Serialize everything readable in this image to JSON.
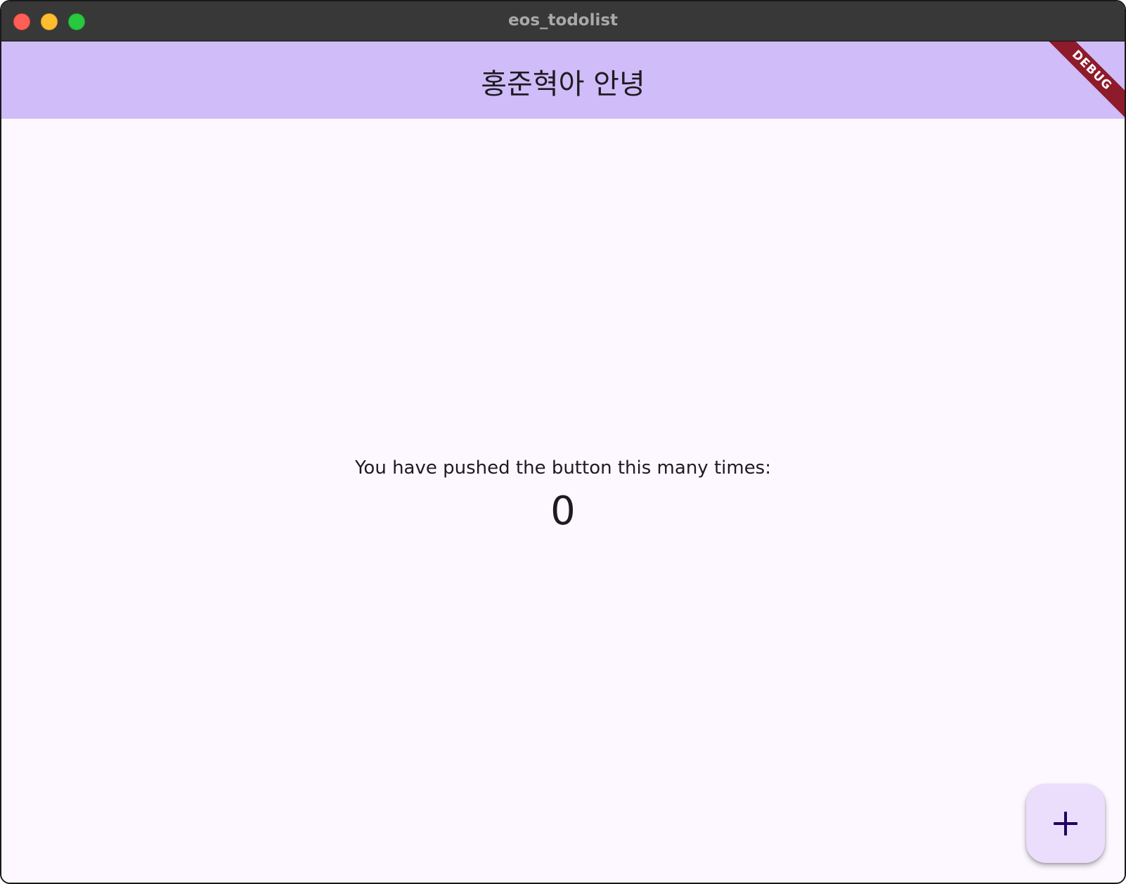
{
  "window": {
    "title": "eos_todolist",
    "controls": [
      "close-button",
      "minimize-button",
      "zoom-button"
    ]
  },
  "appbar": {
    "title": "홍준혁아 안녕",
    "background": "#d0bcf8"
  },
  "debug_banner": {
    "label": "DEBUG",
    "color": "#8e1b2b"
  },
  "main": {
    "counter_label": "You have pushed the button this many times:",
    "counter_value": "0"
  },
  "fab": {
    "icon": "plus-icon",
    "background": "#ebdefc"
  }
}
